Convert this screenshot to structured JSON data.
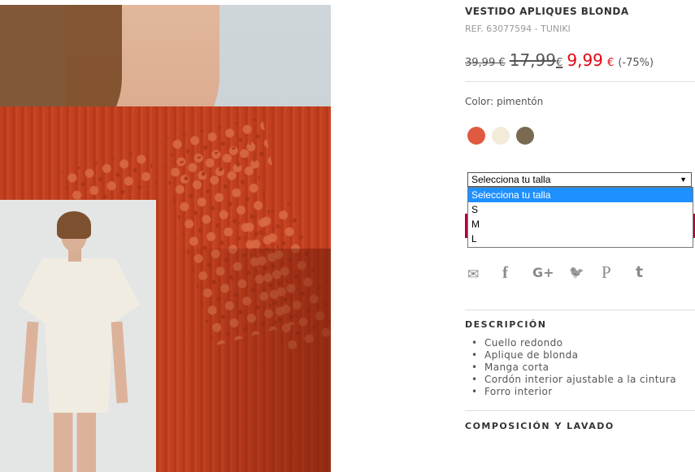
{
  "product": {
    "title": "VESTIDO APLIQUES BLONDA",
    "ref": "REF. 63077594 - TUNIKI",
    "price_old_1": "39,99 €",
    "price_old_2_main": "17,99",
    "price_old_2_cur": "€",
    "price_current_main": "9,99",
    "price_current_cur": "€",
    "discount": "(-75%)",
    "color_label": "Color: pimentón"
  },
  "swatches": [
    {
      "name": "pimentón",
      "color": "#e05a42"
    },
    {
      "name": "crudo",
      "color": "#f3ead9"
    },
    {
      "name": "marrón",
      "color": "#7a6a52"
    }
  ],
  "size_select": {
    "value": "Selecciona tu talla",
    "options": [
      "Selecciona tu talla",
      "S",
      "M",
      "L"
    ]
  },
  "share_icons": [
    "mail-icon",
    "facebook-icon",
    "google-plus-icon",
    "twitter-icon",
    "pinterest-icon",
    "tumblr-icon"
  ],
  "share_glyphs": {
    "mail": "✉",
    "facebook": "f",
    "google": "G+",
    "twitter": "🐦",
    "pinterest": "P",
    "tumblr": "t"
  },
  "description": {
    "title": "DESCRIPCIÓN",
    "items": [
      "Cuello redondo",
      "Aplique de blonda",
      "Manga corta",
      "Cordón interior ajustable a la cintura",
      "Forro interior"
    ]
  },
  "composition": {
    "title": "COMPOSICIÓN Y LAVADO"
  },
  "colors": {
    "price_sale": "#e30613",
    "select_highlight": "#1e90ff"
  }
}
